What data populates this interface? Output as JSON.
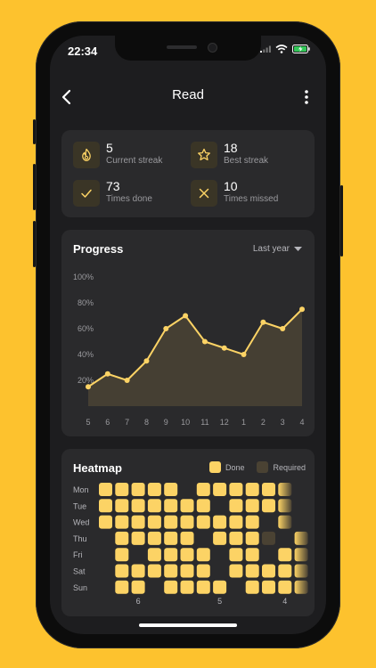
{
  "status": {
    "time": "22:34"
  },
  "nav": {
    "title": "Read"
  },
  "stats": [
    {
      "value": "5",
      "label": "Current streak",
      "icon": "flame-icon"
    },
    {
      "value": "18",
      "label": "Best streak",
      "icon": "star-icon"
    },
    {
      "value": "73",
      "label": "Times done",
      "icon": "check-icon"
    },
    {
      "value": "10",
      "label": "Times missed",
      "icon": "x-icon"
    }
  ],
  "progress": {
    "title": "Progress",
    "period": "Last year"
  },
  "chart_data": {
    "type": "area",
    "categories": [
      "5",
      "6",
      "7",
      "8",
      "9",
      "10",
      "11",
      "12",
      "1",
      "2",
      "3",
      "4"
    ],
    "values": [
      15,
      25,
      20,
      35,
      60,
      70,
      50,
      45,
      40,
      65,
      60,
      75
    ],
    "y_ticks": [
      "100%",
      "80%",
      "60%",
      "40%",
      "20%"
    ],
    "ylim": [
      0,
      100
    ],
    "grid": false
  },
  "heatmap": {
    "title": "Heatmap",
    "legend_done": "Done",
    "legend_required": "Required",
    "days": [
      "Mon",
      "Tue",
      "Wed",
      "Thu",
      "Fri",
      "Sat",
      "Sun"
    ],
    "x_labels": [
      {
        "col": 2,
        "label": "6"
      },
      {
        "col": 7,
        "label": "5"
      },
      {
        "col": 11,
        "label": "4"
      }
    ],
    "rows": [
      "2222202222230",
      "2222222022230",
      "2222222222030",
      "0222220222103",
      "0202222022023",
      "0222222022223",
      "0220222202223"
    ]
  },
  "colors": {
    "accent": "#FCD365",
    "required": "#4A4233",
    "bg": "#1D1D1F",
    "card": "#2A2A2C"
  }
}
